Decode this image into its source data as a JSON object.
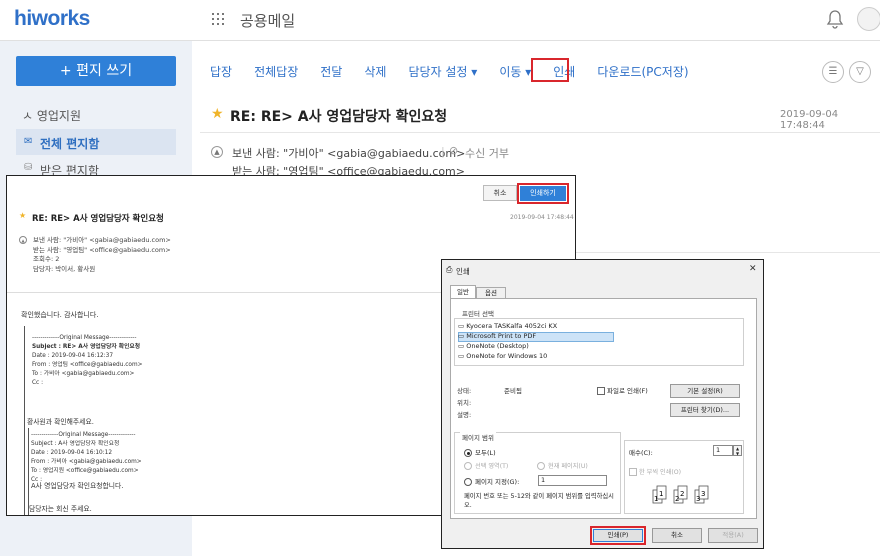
{
  "app": {
    "logo": "hiworks",
    "title": "공용메일"
  },
  "colors": {
    "accent": "#2f80d8",
    "highlight": "#d9262c",
    "star": "#f0b429"
  },
  "sidebar": {
    "compose": "+ 편지 쓰기",
    "group": "ㅅ  영업지원",
    "items": [
      {
        "label": "전체 편지함"
      },
      {
        "label": "받은 편지함"
      }
    ]
  },
  "toolbar": {
    "items": [
      "답장",
      "전체답장",
      "전달",
      "삭제",
      "담당자 설정 ▾",
      "이동 ▾",
      "인쇄",
      "다운로드(PC저장)"
    ]
  },
  "mail": {
    "subject": "RE: RE> A사 영업담당자 확인요청",
    "date": "2019-09-04 17:48:44",
    "from": "보낸 사람: \"가비아\" <gabia@gabiaedu.com>",
    "reject": "수신 거부",
    "to": "받는 사람: \"영업팀\" <office@gabiaedu.com>"
  },
  "preview": {
    "cancel": "취소",
    "print": "인쇄하기",
    "subject": "RE: RE> A사 영업담당자 확인요청",
    "date": "2019-09-04 17:48:44",
    "header": [
      "보낸 사람: \"가비아\" <gabia@gabiaedu.com>",
      "받는 사람: \"영업팀\" <office@gabiaedu.com>",
      "조회수: 2",
      "담당자: 박이서, 황사원"
    ],
    "body": "확인했습니다. 감사합니다.",
    "quote1": [
      "-------------Original Message-------------",
      "Subject : RE> A사 영업담당자 확인요청",
      "Date : 2019-09-04 16:12:37",
      "From : 영업팀 <office@gabiaedu.com>",
      "To : 가비아 <gabia@gabiaedu.com>",
      "Cc :"
    ],
    "reply1": "황사원과 확인해주세요.",
    "quote2": [
      "-------------Original Message-------------",
      "Subject : A사 영업담당자 확인요청",
      "Date : 2019-09-04 16:10:12",
      "From : 가비아 <gabia@gabiaedu.com>",
      "To : 영업지원 <office@gabiaedu.com>",
      "Cc :"
    ],
    "reply2": "A사 영업담당자 확인요청합니다.",
    "reply3": "담당자는 회신 주세요."
  },
  "dialog": {
    "title": "인쇄",
    "close": "✕",
    "tabs": [
      "일반",
      "옵션"
    ],
    "printer_group": "프린터 선택",
    "printers": [
      "Kyocera TASKalfa 4052ci KX",
      "Microsoft Print to PDF",
      "OneNote (Desktop)",
      "OneNote for Windows 10"
    ],
    "selected_printer": "Microsoft Print to PDF",
    "status_label": "상태:",
    "status_value": "준비됨",
    "location_label": "위치:",
    "comment_label": "설명:",
    "print_to_file": "파일로 인쇄(F)",
    "preferences": "기본 설정(R)",
    "find_printer": "프린터 찾기(D)...",
    "range_group": "페이지 범위",
    "range_all": "모두(L)",
    "range_selection": "선택 영역(T)",
    "range_current": "현재 페이지(U)",
    "range_pages": "페이지 지정(G):",
    "range_pages_value": "1",
    "range_hint": "페이지 번호 또는 5-12와 같이 페이지 범위를 입력하십시오.",
    "copies_label": "매수(C):",
    "copies_value": "1",
    "collate": "한 부씩 인쇄(O)",
    "ok": "인쇄(P)",
    "cancel": "취소",
    "apply": "적용(A)"
  }
}
